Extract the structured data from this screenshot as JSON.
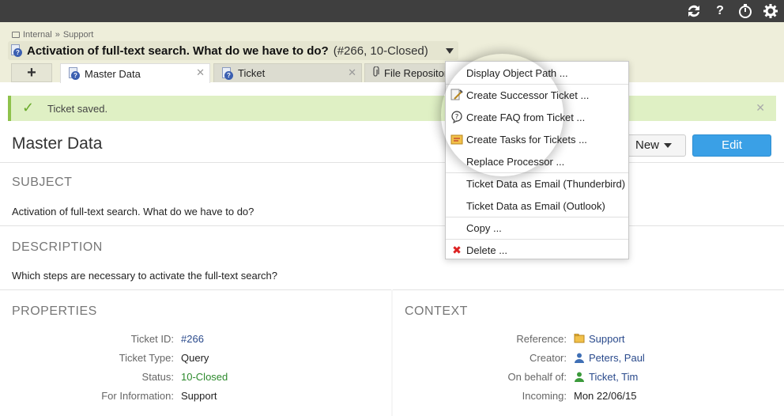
{
  "topbar": {
    "icons": [
      "refresh-icon",
      "help-icon",
      "timer-icon",
      "gear-icon"
    ],
    "help_glyph": "?"
  },
  "breadcrumb": {
    "items": [
      "Internal",
      "»",
      "Support"
    ]
  },
  "title": {
    "subject": "Activation of full-text search. What do we have to do?",
    "suffix": "(#266, 10-Closed)"
  },
  "tabs": {
    "add_label": "+",
    "items": [
      {
        "label": "Master Data",
        "close": "✕"
      },
      {
        "label": "Ticket",
        "close": "✕"
      },
      {
        "label": "File Repository"
      }
    ]
  },
  "notice": {
    "message": "Ticket saved.",
    "check": "✓",
    "close": "✕"
  },
  "page_title": "Master Data",
  "buttons": {
    "new_label": "New",
    "edit_label": "Edit"
  },
  "subject": {
    "heading": "SUBJECT",
    "text": "Activation of full-text search. What do we have to do?"
  },
  "description": {
    "heading": "DESCRIPTION",
    "text": "Which steps are necessary to activate the full-text search?"
  },
  "properties": {
    "heading": "PROPERTIES",
    "rows": [
      {
        "label": "Ticket ID:",
        "value": "#266"
      },
      {
        "label": "Ticket Type:",
        "value": "Query"
      },
      {
        "label": "Status:",
        "value": "10-Closed"
      },
      {
        "label": "For Information:",
        "value": "Support"
      }
    ]
  },
  "context": {
    "heading": "CONTEXT",
    "rows": [
      {
        "label": "Reference:",
        "value": "Support"
      },
      {
        "label": "Creator:",
        "value": "Peters, Paul"
      },
      {
        "label": "On behalf of:",
        "value": "Ticket, Tim"
      },
      {
        "label": "Incoming:",
        "value": "Mon 22/06/15"
      }
    ]
  },
  "menu": {
    "items": [
      "Display Object Path ...",
      "Create Successor Ticket ...",
      "Create FAQ from Ticket ...",
      "Create Tasks for Tickets ...",
      "Replace Processor ...",
      "Ticket Data as Email (Thunderbird)",
      "Ticket Data as Email (Outlook)",
      "Copy ...",
      "Delete ..."
    ],
    "delete_glyph": "✖"
  },
  "colors": {
    "topbar": "#3f3f3f",
    "header": "#eeeeda",
    "notice_bg": "#dff0c4",
    "edit_button": "#3aa0e6",
    "status_green": "#2d8a2d",
    "link": "#2a4a8c"
  }
}
